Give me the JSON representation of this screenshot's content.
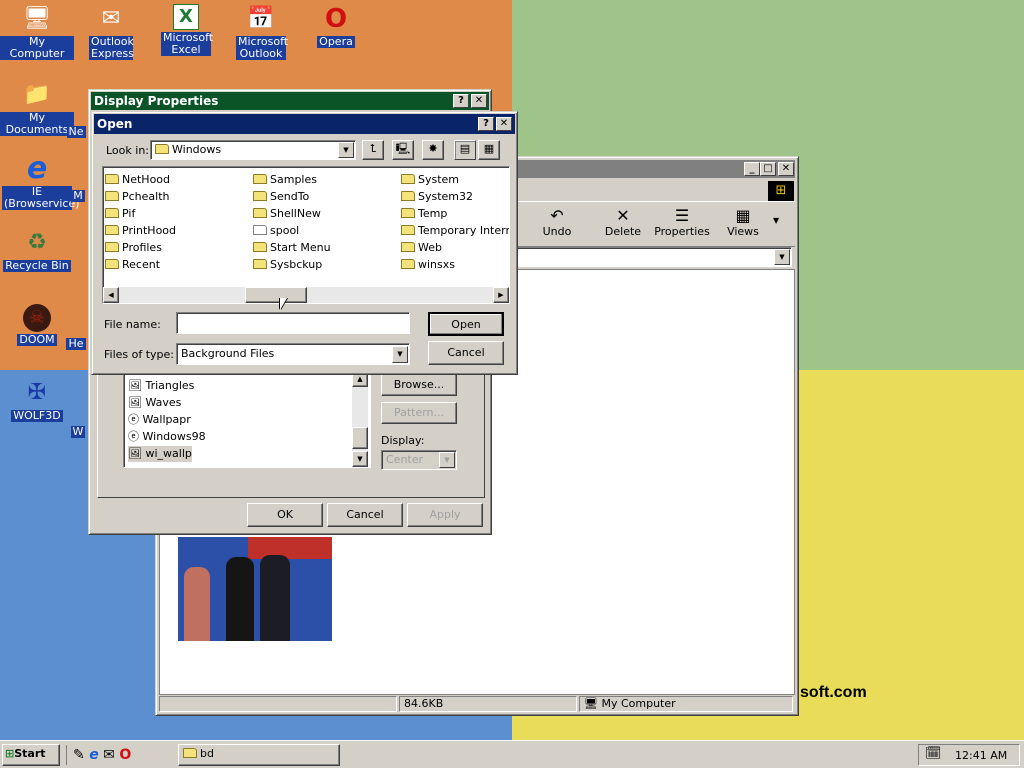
{
  "desktop": {
    "icons": [
      {
        "label": "My Computer",
        "glyph": "🖥"
      },
      {
        "label": "Outlook Express",
        "glyph": "✉"
      },
      {
        "label": "Microsoft Excel",
        "glyph": "X"
      },
      {
        "label": "Microsoft Outlook",
        "glyph": "📅"
      },
      {
        "label": "Opera",
        "glyph": "O"
      },
      {
        "label": "My Documents",
        "glyph": "📁"
      },
      {
        "label": "IE (Browservice)",
        "glyph": "e"
      },
      {
        "label": "Recycle Bin",
        "glyph": "♻"
      },
      {
        "label": "DOOM",
        "glyph": "☠"
      },
      {
        "label": "WOLF3D",
        "glyph": "✠"
      }
    ],
    "partial_labels": [
      "Ne",
      "M",
      "He",
      "W"
    ],
    "brand_text": "soft.com"
  },
  "explorer": {
    "toolbar": [
      "Undo",
      "Delete",
      "Properties",
      "Views"
    ],
    "status": {
      "size": "84.6KB",
      "location": "My Computer"
    }
  },
  "display_properties": {
    "title": "Display Properties",
    "wallpapers": [
      "Triangles",
      "Waves",
      "Wallpapr",
      "Windows98",
      "wi_wallp"
    ],
    "browse": "Browse...",
    "pattern": "Pattern...",
    "display_label": "Display:",
    "display_value": "Center",
    "ok": "OK",
    "cancel": "Cancel",
    "apply": "Apply"
  },
  "open_dialog": {
    "title": "Open",
    "look_in_label": "Look in:",
    "look_in_value": "Windows",
    "col1": [
      "NetHood",
      "Pchealth",
      "Pif",
      "PrintHood",
      "Profiles",
      "Recent"
    ],
    "col2": [
      "Samples",
      "SendTo",
      "ShellNew",
      "spool",
      "Start Menu",
      "Sysbckup"
    ],
    "col3": [
      "System",
      "System32",
      "Temp",
      "Temporary Internet",
      "Web",
      "winsxs"
    ],
    "file_name_label": "File name:",
    "file_name_value": "",
    "files_of_type_label": "Files of type:",
    "files_of_type_value": "Background Files",
    "open": "Open",
    "cancel": "Cancel"
  },
  "taskbar": {
    "start": "Start",
    "task": "bd",
    "clock": "12:41 AM"
  },
  "colors": {
    "title_active": "#0a246a",
    "title_inactive": "#808080",
    "desktop_blue": "#3a6ea5"
  }
}
